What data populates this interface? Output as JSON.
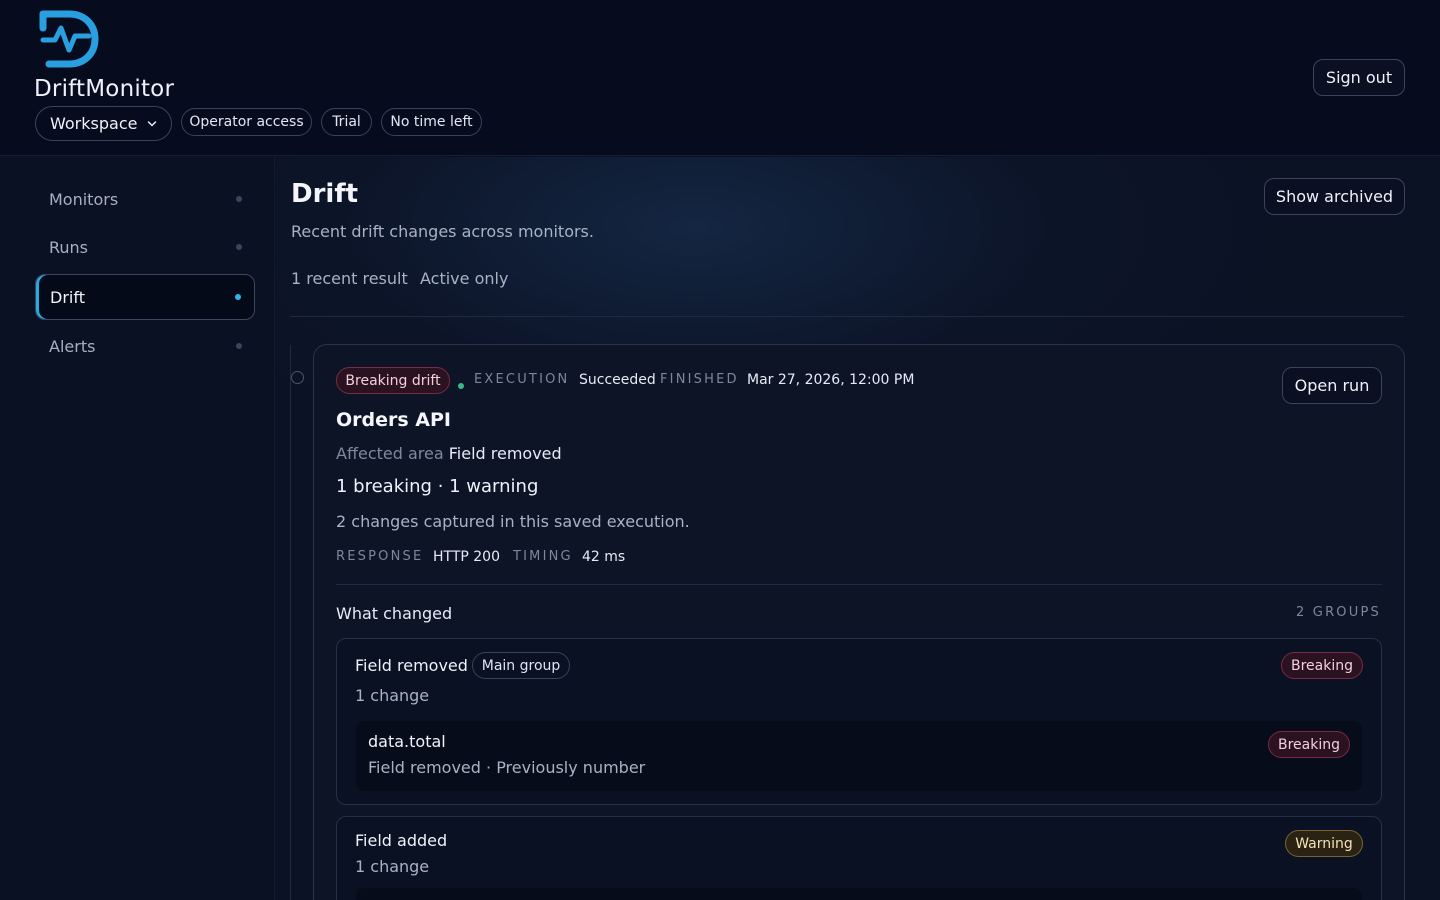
{
  "app": {
    "name": "DriftMonitor",
    "workspace_label": "Workspace",
    "badges": [
      "Operator access",
      "Trial",
      "No time left"
    ],
    "sign_out": "Sign out"
  },
  "sidebar": {
    "items": [
      {
        "label": "Monitors",
        "active": false
      },
      {
        "label": "Runs",
        "active": false
      },
      {
        "label": "Drift",
        "active": true
      },
      {
        "label": "Alerts",
        "active": false
      }
    ]
  },
  "page": {
    "title": "Drift",
    "subtitle": "Recent drift changes across monitors.",
    "show_archived": "Show archived",
    "result_count": "1 recent result",
    "filter": "Active only"
  },
  "result": {
    "severity_badge": "Breaking drift",
    "execution_label": "EXECUTION",
    "execution_status": "Succeeded",
    "finished_label": "FINISHED",
    "finished_at": "Mar 27, 2026, 12:00 PM",
    "open_run": "Open run",
    "monitor_name": "Orders API",
    "affected_label": "Affected area",
    "affected_value": "Field removed",
    "summary": "1 breaking · 1 warning",
    "captured": "2 changes captured in this saved execution.",
    "response_label": "RESPONSE",
    "response_value": "HTTP 200",
    "timing_label": "TIMING",
    "timing_value": "42 ms",
    "what_changed": "What changed",
    "group_count": "2 GROUPS",
    "groups": [
      {
        "title": "Field removed",
        "tag": "Main group",
        "count": "1 change",
        "severity": "Breaking",
        "changes": [
          {
            "path": "data.total",
            "detail": "Field removed · Previously number",
            "severity": "Breaking"
          }
        ]
      },
      {
        "title": "Field added",
        "count": "1 change",
        "severity": "Warning"
      }
    ]
  },
  "colors": {
    "accent": "#2fb5ee",
    "breaking": "#7a2a44",
    "warning": "#7a6330",
    "success": "#39b889"
  }
}
